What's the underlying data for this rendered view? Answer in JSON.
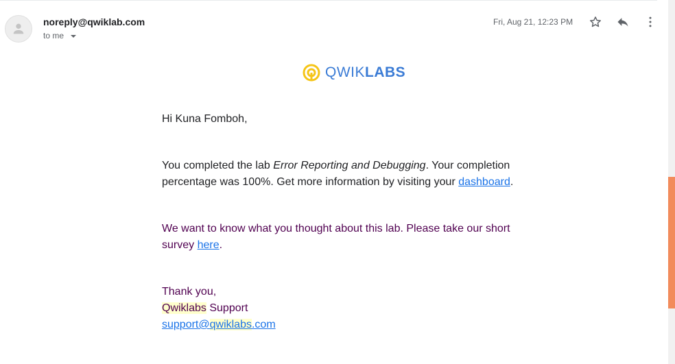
{
  "header": {
    "sender": "noreply@qwiklab.com",
    "recipient_label": "to me",
    "date": "Fri, Aug 21, 12:23 PM"
  },
  "icons": {
    "avatar": "person-icon",
    "star": "star-icon",
    "reply": "reply-icon",
    "more": "more-vert-icon",
    "dropdown": "chevron-down-icon",
    "logo": "qwiklabs-logo-icon"
  },
  "logo": {
    "part1": "QWIK",
    "part2": "LABS"
  },
  "email": {
    "greeting": "Hi Kuna Fomboh,",
    "completion": {
      "text_before": "You completed the lab ",
      "lab_name": "Error Reporting and Debugging",
      "text_after": ". Your completion percentage was 100%. Get more information by visiting your ",
      "link_text": "dashboard",
      "end": "."
    },
    "survey": {
      "text": "We want to know what you thought about this lab. Please take our short survey ",
      "link_text": "here",
      "end": "."
    },
    "signoff": {
      "thanks": "Thank you,",
      "company_highlight": "Qwiklabs",
      "company_rest": " Support",
      "email_prefix": "support@",
      "email_highlight": "qwiklabs",
      "email_suffix": ".com"
    }
  },
  "colors": {
    "link": "#1a73e8",
    "purple_text": "#500050",
    "logo_blue": "#3a7bd5",
    "logo_yellow": "#f5c518",
    "scroll_thumb": "#f28b5b"
  }
}
